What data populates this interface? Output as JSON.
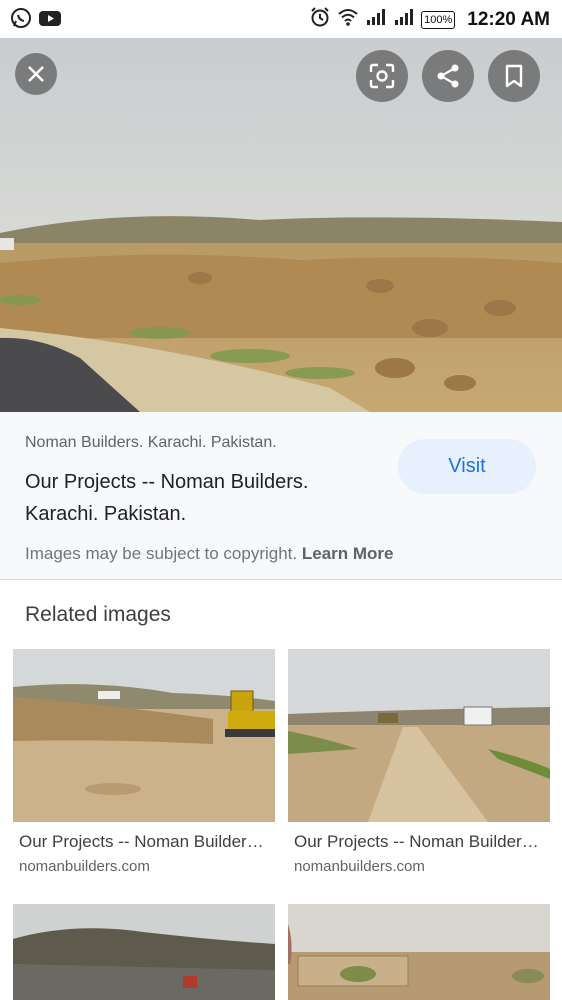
{
  "status_bar": {
    "time": "12:20 AM",
    "battery": "100%",
    "left_icons": [
      "whatsapp-icon",
      "youtube-icon"
    ],
    "right_icons": [
      "alarm-icon",
      "wifi-icon",
      "signal-icon",
      "signal-icon",
      "battery-icon"
    ]
  },
  "viewer": {
    "close_icon": "close-icon",
    "actions": [
      "lens-icon",
      "share-icon",
      "bookmark-icon"
    ]
  },
  "info": {
    "source": "Noman Builders. Karachi. Pakistan.",
    "title": "Our Projects -- Noman Builders. Karachi. Pakistan.",
    "visit_label": "Visit",
    "copyright_text": "Images may be subject to copyright.",
    "learn_more_label": "Learn More"
  },
  "related": {
    "heading": "Related images",
    "items": [
      {
        "title": "Our Projects -- Noman Builders. Karachi. Pakistan.",
        "site": "nomanbuilders.com"
      },
      {
        "title": "Our Projects -- Noman Builders. Karachi. Pakistan.",
        "site": "nomanbuilders.com"
      },
      {
        "title": "",
        "site": ""
      },
      {
        "title": "",
        "site": ""
      }
    ]
  },
  "colors": {
    "accent": "#1a73e8",
    "visit_bg": "#e8f0fe",
    "panel_bg": "#f8f9fa"
  }
}
